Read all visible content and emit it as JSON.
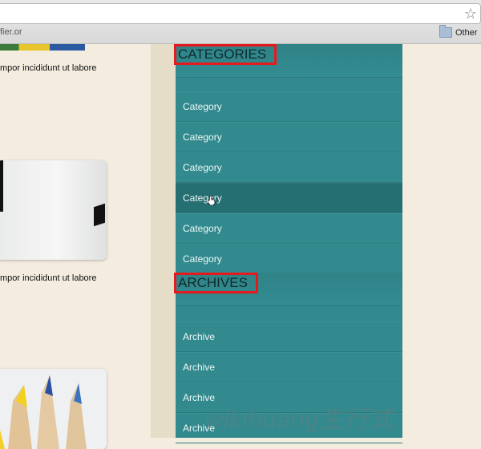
{
  "browser": {
    "bookmark_left": "fier.or",
    "bookmark_right": "Other"
  },
  "left": {
    "excerpt_1": "mpor incididunt ut labore",
    "excerpt_2": "mpor incididunt ut labore"
  },
  "sidebar": {
    "categories_title": "CATEGORIES",
    "categories": [
      "Category",
      "Category",
      "Category",
      "Category",
      "Category",
      "Category"
    ],
    "archives_title": "ARCHIVES",
    "archives": [
      "Archive",
      "Archive",
      "Archive",
      "Archive"
    ]
  },
  "overlay": {
    "watermark": "wikihuang生行式"
  }
}
